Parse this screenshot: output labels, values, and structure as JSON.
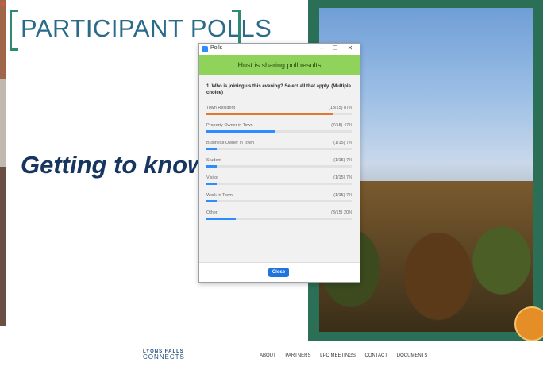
{
  "slide": {
    "title": "PARTICIPANT POLLS",
    "subtitle": "Getting to know"
  },
  "poll_window": {
    "title": "Polls",
    "minimize": "–",
    "maximize": "☐",
    "close": "✕",
    "banner": "Host is sharing poll results",
    "question": "1. Who is joining us this evening? Select all that apply. (Multiple choice)",
    "options": [
      {
        "label": "Town Resident",
        "stat": "(13/15) 87%",
        "percent": 87
      },
      {
        "label": "Property Owner in Town",
        "stat": "(7/15) 47%",
        "percent": 47
      },
      {
        "label": "Business Owner in Town",
        "stat": "(1/15) 7%",
        "percent": 7
      },
      {
        "label": "Student",
        "stat": "(1/15) 7%",
        "percent": 7
      },
      {
        "label": "Visitor",
        "stat": "(1/15) 7%",
        "percent": 7
      },
      {
        "label": "Work in Town",
        "stat": "(1/15) 7%",
        "percent": 7
      },
      {
        "label": "Other",
        "stat": "(3/15) 20%",
        "percent": 20
      }
    ],
    "close_button": "Close"
  },
  "footer": {
    "logo_line1": "LYONS FALLS",
    "logo_line2": "CONNECTS",
    "nav": [
      "ABOUT",
      "PARTNERS",
      "LPC MEETINGS",
      "CONTACT",
      "DOCUMENTS"
    ]
  },
  "colors": {
    "title_teal": "#2a6b8a",
    "bracket_green": "#2f8a74",
    "subtitle_navy": "#17365f",
    "banner_green": "#8fd35a",
    "bar_blue": "#2d8cff",
    "bar_orange": "#e4762e"
  }
}
